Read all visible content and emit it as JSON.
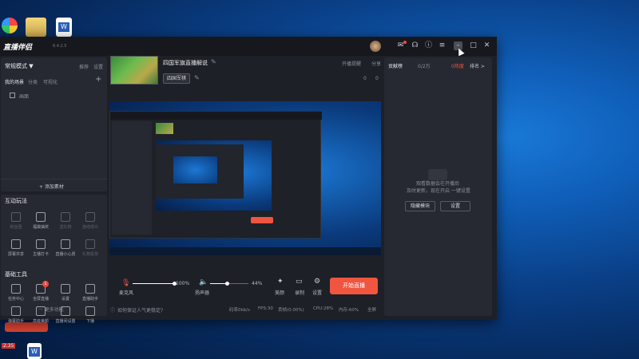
{
  "desktop": {
    "top_labels": [
      "...",
      "...",
      "...",
      "..."
    ],
    "bottom_badge": "2.35"
  },
  "window": {
    "app_name": "直播伴侣",
    "version": "6.4.2.5",
    "room_title": "四国军旗直播解说",
    "category_btn": "四国军棋",
    "share_label": "开播提醒",
    "official_label": "分享",
    "likes": "0",
    "comments": "0"
  },
  "left": {
    "mode": "常规模式 ▼",
    "mode_actions": [
      "推荐",
      "设置"
    ],
    "scene_tabs": [
      "我的场景",
      "分类",
      "可视化"
    ],
    "scene_item": "画面",
    "add_material": "+ 添加素材",
    "interact_title": "互动玩法",
    "interact_items": [
      "粉丝团",
      "福袋抽奖",
      "送礼物",
      "连线观众",
      "屏幕共享",
      "主播打卡",
      "直播小心愿",
      "礼物投票"
    ],
    "tools_title": "基础工具",
    "tools_items": [
      "任务中心",
      "全屏直播",
      "设置",
      "直播助手",
      "弹幕助手",
      "高级美颜",
      "直播间设置",
      "下播"
    ],
    "more": "··· 更多功能"
  },
  "right": {
    "tabs": [
      "贡献榜",
      "0/2万"
    ],
    "hot_label": "0热度",
    "rank_label": "排名 >",
    "empty_line1": "观看数据会在开播后",
    "empty_line2": "及时更新，现在开启 一键设置",
    "btn_left": "隐藏模块",
    "btn_right": "设置"
  },
  "bottom": {
    "mic_label": "麦克风",
    "mic_value": 100,
    "mic_value_text": "100%",
    "speaker_label": "扬声器",
    "speaker_value": 44,
    "speaker_value_text": "44%",
    "icons": [
      "美颜",
      "录制",
      "设置"
    ],
    "start": "开始直播",
    "help": "如何保证人气更稳定?",
    "stats": [
      "码率0kb/s",
      "FPS:30",
      "丢帧(0.00%)",
      "CPU:28%",
      "内存:60%",
      "全屏"
    ]
  }
}
